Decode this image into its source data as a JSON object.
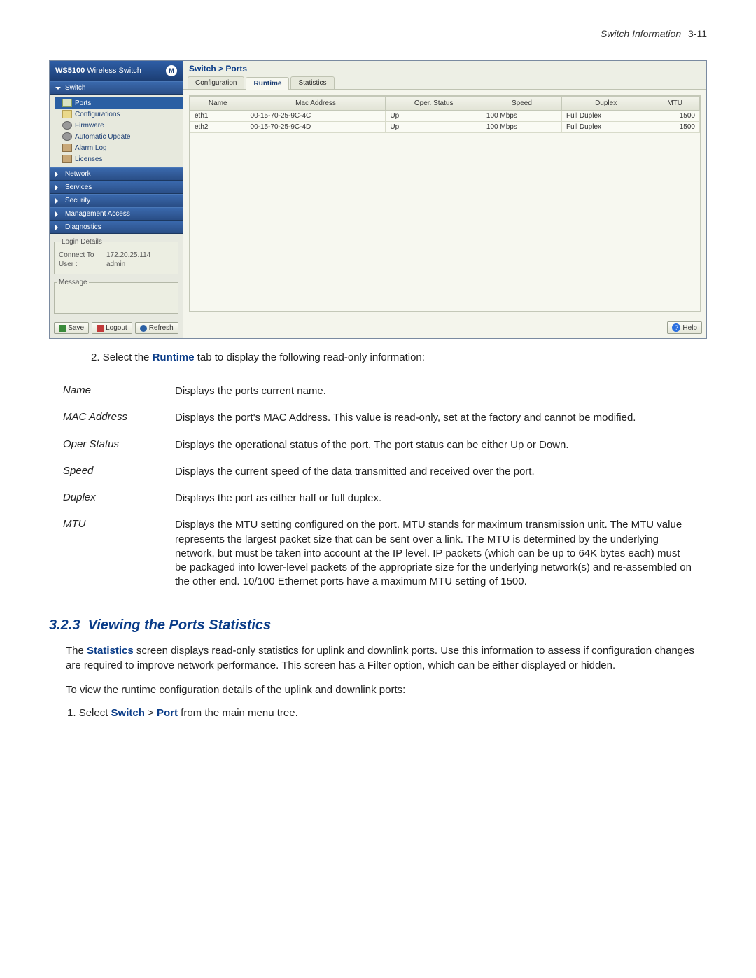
{
  "header": {
    "label": "Switch Information",
    "page": "3-11"
  },
  "brand": {
    "name_bold": "WS5100",
    "name_rest": "Wireless Switch",
    "logo": "M"
  },
  "nav": {
    "switch": "Switch",
    "items": [
      {
        "label": "Ports",
        "icon": "port",
        "sel": true
      },
      {
        "label": "Configurations",
        "icon": "folder"
      },
      {
        "label": "Firmware",
        "icon": "gear"
      },
      {
        "label": "Automatic Update",
        "icon": "gear"
      },
      {
        "label": "Alarm Log",
        "icon": "disk"
      },
      {
        "label": "Licenses",
        "icon": "disk"
      }
    ],
    "groups": [
      "Network",
      "Services",
      "Security",
      "Management Access",
      "Diagnostics"
    ]
  },
  "login": {
    "legend": "Login Details",
    "connect_k": "Connect To :",
    "connect_v": "172.20.25.114",
    "user_k": "User :",
    "user_v": "admin",
    "msg": "Message"
  },
  "buttons": {
    "save": "Save",
    "logout": "Logout",
    "refresh": "Refresh",
    "help": "Help"
  },
  "crumb": "Switch > Ports",
  "tabs": [
    "Configuration",
    "Runtime",
    "Statistics"
  ],
  "active_tab": 1,
  "table": {
    "cols": [
      "Name",
      "Mac Address",
      "Oper. Status",
      "Speed",
      "Duplex",
      "MTU"
    ],
    "rows": [
      {
        "name": "eth1",
        "mac": "00-15-70-25-9C-4C",
        "oper": "Up",
        "speed": "100 Mbps",
        "duplex": "Full Duplex",
        "mtu": "1500"
      },
      {
        "name": "eth2",
        "mac": "00-15-70-25-9C-4D",
        "oper": "Up",
        "speed": "100 Mbps",
        "duplex": "Full Duplex",
        "mtu": "1500"
      }
    ]
  },
  "instr": {
    "n": "2.",
    "a": "Select the ",
    "b": "Runtime",
    "c": " tab to display the following read-only information:"
  },
  "defs": [
    {
      "term": "Name",
      "desc": "Displays the ports current name."
    },
    {
      "term": "MAC Address",
      "desc": "Displays the port's MAC Address. This value is read-only, set at the factory and cannot be modified."
    },
    {
      "term": "Oper Status",
      "desc": "Displays the operational status of the port. The port status can be either Up or Down."
    },
    {
      "term": "Speed",
      "desc": "Displays the current speed of the data transmitted and received over the port."
    },
    {
      "term": "Duplex",
      "desc": "Displays the port as either half or full duplex."
    },
    {
      "term": "MTU",
      "desc": "Displays the MTU setting configured on the port. MTU stands for maximum transmission unit. The MTU value represents the largest packet size that can be sent over a link. The MTU is determined by the underlying network, but must be taken into account at the IP level. IP packets (which can be up to 64K bytes each) must be packaged into lower-level packets of the appropriate size for the underlying network(s) and re-assembled on the other end. 10/100 Ethernet ports have a maximum MTU setting of 1500."
    }
  ],
  "section": {
    "num": "3.2.3",
    "title": "Viewing the Ports Statistics"
  },
  "para1": {
    "a": "The ",
    "b": "Statistics",
    "c": " screen displays read-only statistics for uplink and downlink ports. Use this information to assess if configuration changes are required to improve network performance. This screen has a Filter option, which can be either displayed or hidden."
  },
  "para2": "To view the runtime configuration details of the uplink and downlink ports:",
  "step1": {
    "n": "1.",
    "a": "Select ",
    "b": "Switch",
    "c": " > ",
    "d": "Port",
    "e": " from the main menu tree."
  }
}
